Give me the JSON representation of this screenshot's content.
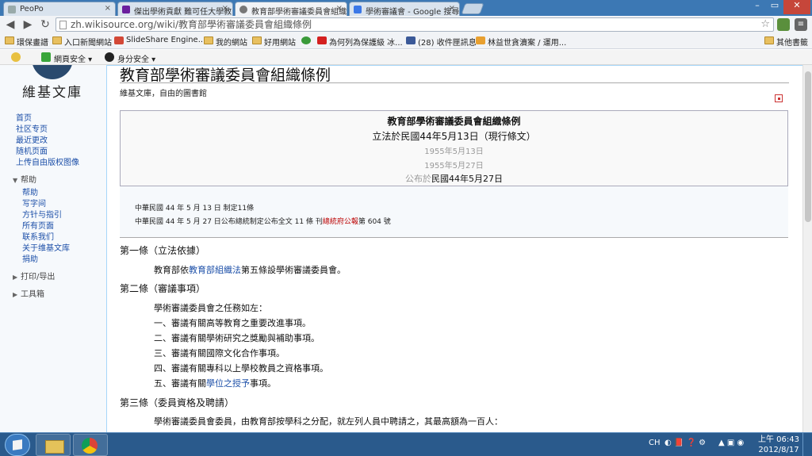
{
  "browser": {
    "tabs": [
      {
        "label": "PeoPo",
        "active": false
      },
      {
        "label": "傑出學術貢獻 難可任大學教",
        "active": false
      },
      {
        "label": "教育部學術審議委員會組織",
        "active": true
      },
      {
        "label": "學術審議會 - Google 搜尋",
        "active": false
      }
    ],
    "window_controls": {
      "minimize": "–",
      "maximize": "▭",
      "close": "✕"
    },
    "back": "◀",
    "forward": "▶",
    "reload": "↻",
    "url": "zh.wikisource.org/wiki/教育部學術審議委員會組織條例",
    "star": "☆",
    "bookmarks": [
      {
        "label": "環保畫譜",
        "icon": "folder-icon"
      },
      {
        "label": "入口新聞網站",
        "icon": "folder-icon"
      },
      {
        "label": "SlideShare Engine...",
        "icon": "slideshare-icon"
      },
      {
        "label": "我的網站",
        "icon": "folder-icon"
      },
      {
        "label": "好用網站",
        "icon": "folder-icon"
      },
      {
        "label": "",
        "icon": "leaf-icon"
      },
      {
        "label": "為何列為保護級 冰...",
        "icon": "youtube-icon"
      },
      {
        "label": "(28) 收件匣訊息",
        "icon": "facebook-icon"
      },
      {
        "label": "林益世貪瀆案 / 運用...",
        "icon": "page-icon"
      },
      {
        "label": "其他書籤",
        "icon": "folder-icon"
      }
    ],
    "ext_toolbar": [
      {
        "label": "網頁安全",
        "icon": "shield-icon"
      },
      {
        "label": "身分安全",
        "icon": "identity-icon"
      }
    ]
  },
  "site": {
    "logo_text": "維基文庫",
    "sidebar_links": [
      "首页",
      "社区专页",
      "最近更改",
      "随机页面",
      "上传自由版权图像"
    ],
    "help_head": "帮助",
    "help_links": [
      "帮助",
      "写字间",
      "方针与指引",
      "所有页面",
      "联系我们",
      "关于维基文库",
      "捐助"
    ],
    "print_head": "打印/导出",
    "tools_head": "工具箱"
  },
  "article": {
    "title": "教育部學術審議委員會組織條例",
    "sitesub": "維基文庫，自由的圖書館",
    "header_title": "教育部學術審議委員會組織條例",
    "header_sub": "立法於民國44年5月13日（現行條文）",
    "grey_date_1": "1955年5月13日",
    "grey_date_2": "1955年5月27日",
    "pub_prefix": "公布於",
    "pub_date": "民國44年5月27日",
    "history_1": "中華民國  44  年  5  月  13  日  制定11條",
    "history_2_a": "中華民國  44  年  5  月  27  日公布",
    "history_2_b": "總統制定公布全文  11  條  刊",
    "history_2_red": "總統府公報",
    "history_2_c": "第  604  號",
    "sections": [
      {
        "head": "第一條（立法依據）"
      },
      {
        "head": "第二條（審議事項）"
      },
      {
        "head": "第三條（委員資格及聘請）"
      }
    ],
    "s1_pre": "教育部依",
    "s1_link": "教育部組織法",
    "s1_post": "第五條設學術審議委員會。",
    "s2_lines": [
      "學術審議委員會之任務如左：",
      "一、審議有關高等教育之重要改進事項。",
      "二、審議有關學術研究之獎勵與補助事項。",
      "三、審議有關國際文化合作事項。",
      "四、審議有關專科以上學校教員之資格事項。"
    ],
    "s2_5_pre": "五、審議有關",
    "s2_5_link": "學位之授予",
    "s2_5_post": "事項。",
    "s3_line": "學術審議委員會委員，由教育部按學科之分配，就左列人員中聘請之，其最高額為一百人："
  },
  "taskbar": {
    "tray_lang": "CH",
    "time": "上午 06:43",
    "date": "2012/8/17"
  }
}
